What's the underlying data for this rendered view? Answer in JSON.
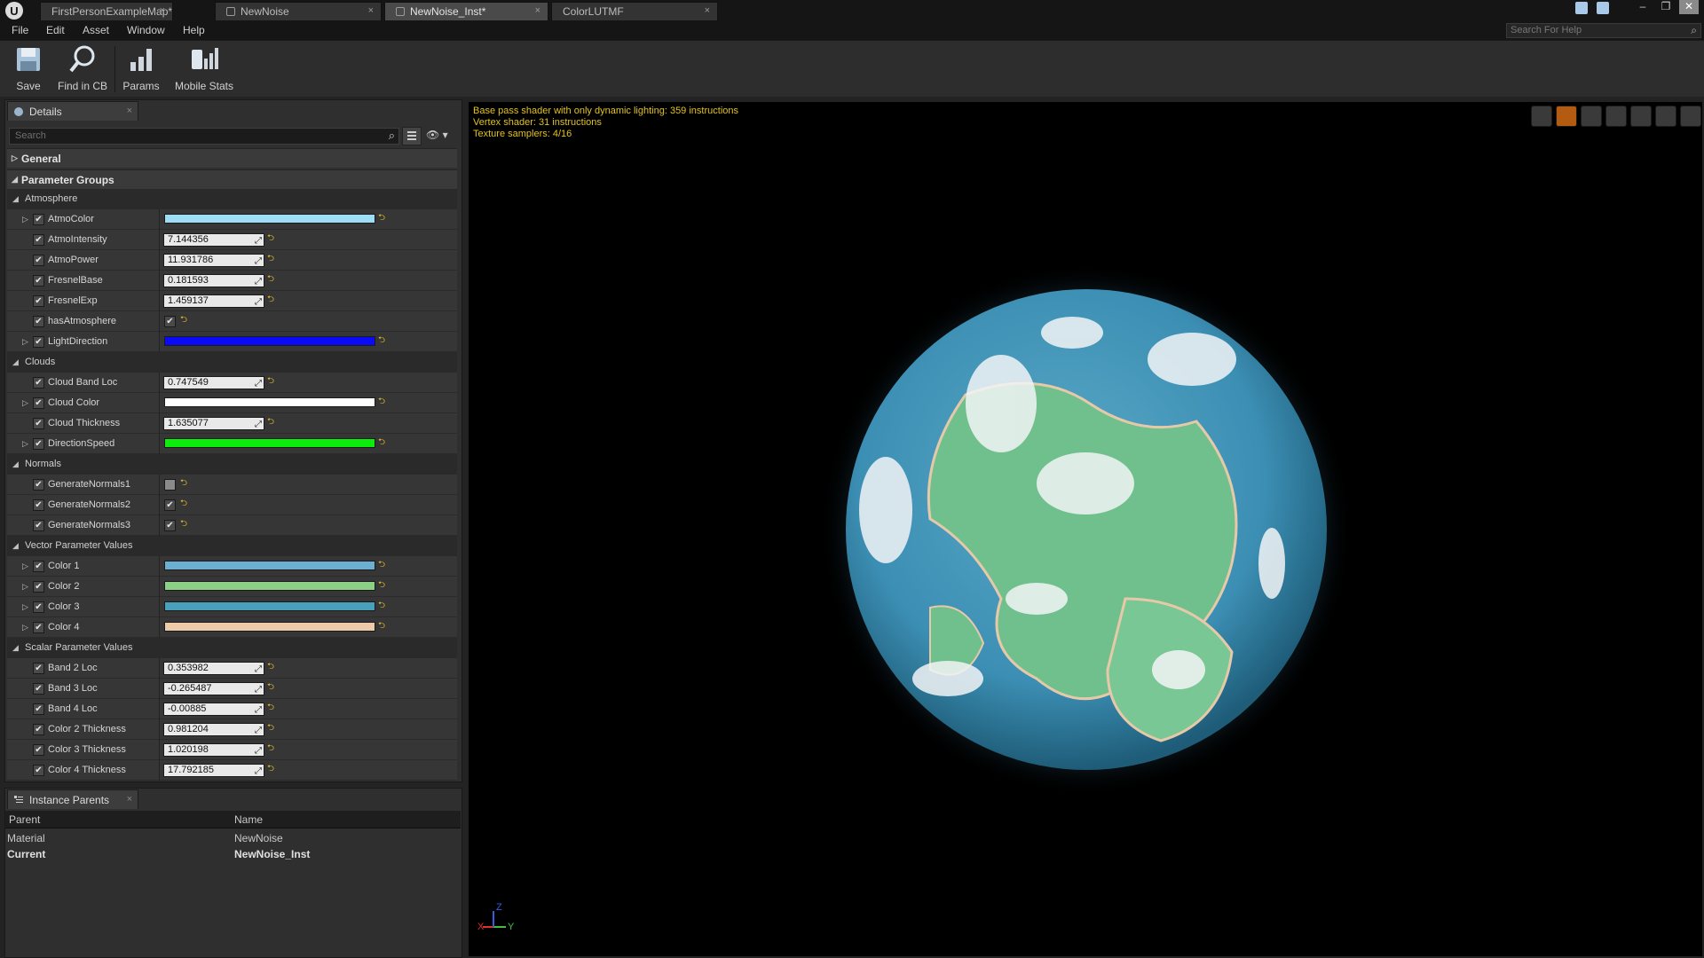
{
  "titlebar": {
    "tabs": [
      {
        "label": "FirstPersonExampleMap*",
        "active": false
      },
      {
        "label": "NewNoise",
        "active": false
      },
      {
        "label": "NewNoise_Inst*",
        "active": true
      },
      {
        "label": "ColorLUTMF",
        "active": false
      }
    ],
    "close_glyph": "×",
    "logo_text": "U",
    "window_buttons": [
      "–",
      "❐",
      "✕"
    ]
  },
  "menu": [
    "File",
    "Edit",
    "Asset",
    "Window",
    "Help"
  ],
  "help_search": {
    "placeholder": "Search For Help"
  },
  "toolbar": [
    {
      "label": "Save",
      "icon": "save-icon"
    },
    {
      "label": "Find in CB",
      "icon": "find-in-cb-icon"
    },
    {
      "label": "Params",
      "icon": "params-icon"
    },
    {
      "label": "Mobile Stats",
      "icon": "mobile-stats-icon"
    }
  ],
  "details": {
    "tab_label": "Details",
    "search_placeholder": "Search",
    "categories": {
      "general": "General",
      "parameter_groups": "Parameter Groups"
    },
    "groups": {
      "atmosphere": "Atmosphere",
      "clouds": "Clouds",
      "normals": "Normals",
      "vector": "Vector Parameter Values",
      "scalar": "Scalar Parameter Values"
    },
    "atmosphere": {
      "atmo_color": {
        "label": "AtmoColor",
        "color": "#9fdcf5"
      },
      "atmo_intensity": {
        "label": "AtmoIntensity",
        "value": "7.144356"
      },
      "atmo_power": {
        "label": "AtmoPower",
        "value": "11.931786"
      },
      "fresnel_base": {
        "label": "FresnelBase",
        "value": "0.181593"
      },
      "fresnel_exp": {
        "label": "FresnelExp",
        "value": "1.459137"
      },
      "has_atmosphere": {
        "label": "hasAtmosphere",
        "checked": true
      },
      "light_direction": {
        "label": "LightDirection",
        "color": "#0a0af5"
      }
    },
    "clouds": {
      "cloud_band_loc": {
        "label": "Cloud Band Loc",
        "value": "0.747549"
      },
      "cloud_color": {
        "label": "Cloud Color",
        "color": "#ffffff"
      },
      "cloud_thickness": {
        "label": "Cloud Thickness",
        "value": "1.635077"
      },
      "direction_speed": {
        "label": "DirectionSpeed",
        "color": "#0ced0c"
      }
    },
    "normals": {
      "gen1": {
        "label": "GenerateNormals1",
        "checked": false
      },
      "gen2": {
        "label": "GenerateNormals2",
        "checked": true
      },
      "gen3": {
        "label": "GenerateNormals3",
        "checked": true
      }
    },
    "vector": {
      "color1": {
        "label": "Color 1",
        "color": "#6cafd0"
      },
      "color2": {
        "label": "Color 2",
        "color": "#8ccf87"
      },
      "color3": {
        "label": "Color 3",
        "color": "#4a9fbb"
      },
      "color4": {
        "label": "Color 4",
        "color": "#eccaaa"
      }
    },
    "scalar": {
      "band2": {
        "label": "Band 2 Loc",
        "value": "0.353982"
      },
      "band3": {
        "label": "Band 3 Loc",
        "value": "-0.265487"
      },
      "band4": {
        "label": "Band 4 Loc",
        "value": "-0.00885"
      },
      "c2t": {
        "label": "Color 2 Thickness",
        "value": "0.981204"
      },
      "c3t": {
        "label": "Color 3 Thickness",
        "value": "1.020198"
      },
      "c4t": {
        "label": "Color 4 Thickness",
        "value": "17.792185"
      }
    },
    "check_glyph": "✔",
    "reset_glyph": "⮌",
    "drag_glyph": "⤢",
    "expand_glyph": "▷",
    "collapse_glyph": "◢"
  },
  "instance_parents": {
    "tab_label": "Instance Parents",
    "headers": {
      "parent": "Parent",
      "name": "Name"
    },
    "rows": [
      {
        "parent": "Material",
        "name": "NewNoise",
        "bold": false
      },
      {
        "parent": "Current",
        "name": "NewNoise_Inst",
        "bold": true
      }
    ]
  },
  "viewport": {
    "stats": [
      "Base pass shader with only dynamic lighting: 359 instructions",
      "Vertex shader: 31 instructions",
      "Texture samplers: 4/16"
    ],
    "axis": {
      "x": "X",
      "y": "Y",
      "z": "Z"
    },
    "colors": {
      "ocean": "#3c8fb4",
      "land": "#6fc08d",
      "cloud": "#f2f4f6",
      "glow": "#2a5a72"
    }
  }
}
